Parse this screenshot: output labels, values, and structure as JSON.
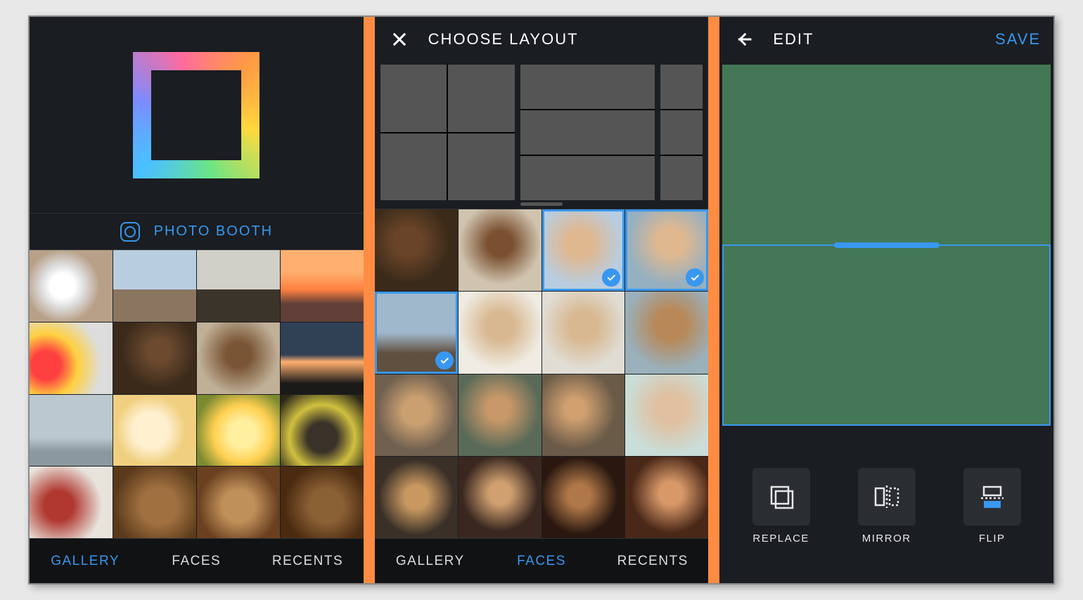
{
  "colors": {
    "accent": "#3897f0",
    "separator": "#ff8c42"
  },
  "screen1": {
    "photo_booth_label": "PHOTO BOOTH",
    "tabs": {
      "gallery": "GALLERY",
      "faces": "FACES",
      "recents": "RECENTS"
    },
    "active_tab": "gallery",
    "gallery_items": [
      "dog-on-floor",
      "person-on-rock",
      "figure-on-cliff",
      "sunset-silhouettes",
      "balloons",
      "curly-hair-portrait",
      "portrait-smile",
      "dusk-palm",
      "kid-blue-wall",
      "breakfast-plates",
      "yellow-flowers",
      "bicycle-leaves",
      "coffee-top",
      "puppy-1",
      "puppy-2",
      "puppy-3"
    ]
  },
  "screen2": {
    "title": "CHOOSE LAYOUT",
    "tabs": {
      "gallery": "GALLERY",
      "faces": "FACES",
      "recents": "RECENTS"
    },
    "active_tab": "faces",
    "selected_indices": [
      2,
      3,
      4
    ],
    "layout_options": [
      "four-grid",
      "three-rows",
      "one-column"
    ],
    "faces_items": [
      "curly-hat",
      "curly-smile",
      "couple-kiss",
      "sunglasses-pair",
      "group-beach",
      "portrait-white",
      "portrait-window",
      "blonde-beach",
      "sunglasses-look",
      "beard-funny",
      "two-funny-faces",
      "glasses-portrait",
      "phone-selfie",
      "trio-smile",
      "night-group",
      "pink-baby"
    ]
  },
  "screen3": {
    "title": "EDIT",
    "save_label": "SAVE",
    "tools": {
      "replace": "REPLACE",
      "mirror": "MIRROR",
      "flip": "FLIP"
    },
    "layout_cells": [
      "mountain-flipped",
      "mountain-jumper"
    ],
    "selected_cell": 1
  }
}
